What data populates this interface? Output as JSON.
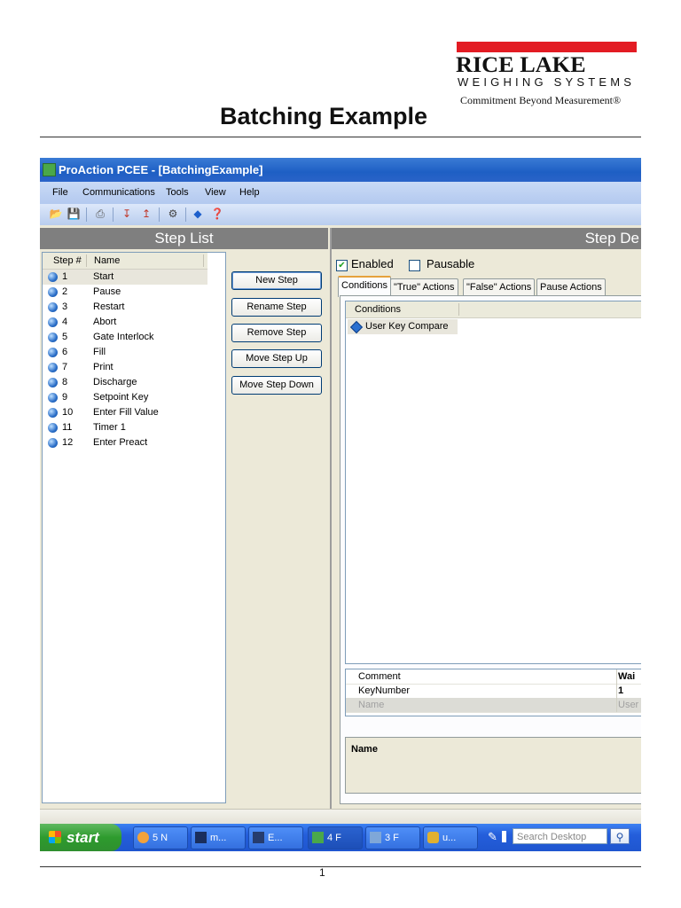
{
  "header": {
    "brand_line1": "RICE LAKE",
    "brand_line2": "WEIGHING SYSTEMS",
    "tagline": "Commitment Beyond Measurement®",
    "doc_title": "Batching Example",
    "page_number": "1"
  },
  "window": {
    "title": "ProAction PCEE - [BatchingExample]",
    "menu": [
      "File",
      "Communications",
      "Tools",
      "View",
      "Help"
    ]
  },
  "toolbar": {
    "icons": [
      "open-folder-icon",
      "save-icon",
      "print-icon",
      "download-icon",
      "upload-icon",
      "connect-icon",
      "run-icon",
      "help-icon"
    ]
  },
  "step_list": {
    "header": "Step List",
    "col_step": "Step #",
    "col_name": "Name",
    "steps": [
      {
        "num": "1",
        "name": "Start"
      },
      {
        "num": "2",
        "name": "Pause"
      },
      {
        "num": "3",
        "name": "Restart"
      },
      {
        "num": "4",
        "name": "Abort"
      },
      {
        "num": "5",
        "name": "Gate Interlock"
      },
      {
        "num": "6",
        "name": "Fill"
      },
      {
        "num": "7",
        "name": "Print"
      },
      {
        "num": "8",
        "name": "Discharge"
      },
      {
        "num": "9",
        "name": "Setpoint Key"
      },
      {
        "num": "10",
        "name": "Enter Fill Value"
      },
      {
        "num": "11",
        "name": "Timer 1"
      },
      {
        "num": "12",
        "name": "Enter Preact"
      }
    ],
    "buttons": {
      "new": "New Step",
      "rename": "Rename Step",
      "remove": "Remove Step",
      "up": "Move Step Up",
      "down": "Move Step Down"
    }
  },
  "step_detail": {
    "header": "Step De",
    "enabled_label": "Enabled",
    "pausable_label": "Pausable",
    "tabs": [
      "Conditions",
      "\"True\" Actions",
      "\"False\" Actions",
      "Pause Actions"
    ],
    "conditions_header": "Conditions",
    "condition_item": "User Key Compare",
    "properties": [
      {
        "key": "Comment",
        "value": "Wai"
      },
      {
        "key": "KeyNumber",
        "value": "1"
      },
      {
        "key": "Name",
        "value": "User"
      }
    ],
    "description_label": "Name"
  },
  "taskbar": {
    "start": "start",
    "items": [
      "5 N",
      "m...",
      "E...",
      "4 F",
      "3 F",
      "u..."
    ],
    "search_placeholder": "Search Desktop"
  }
}
